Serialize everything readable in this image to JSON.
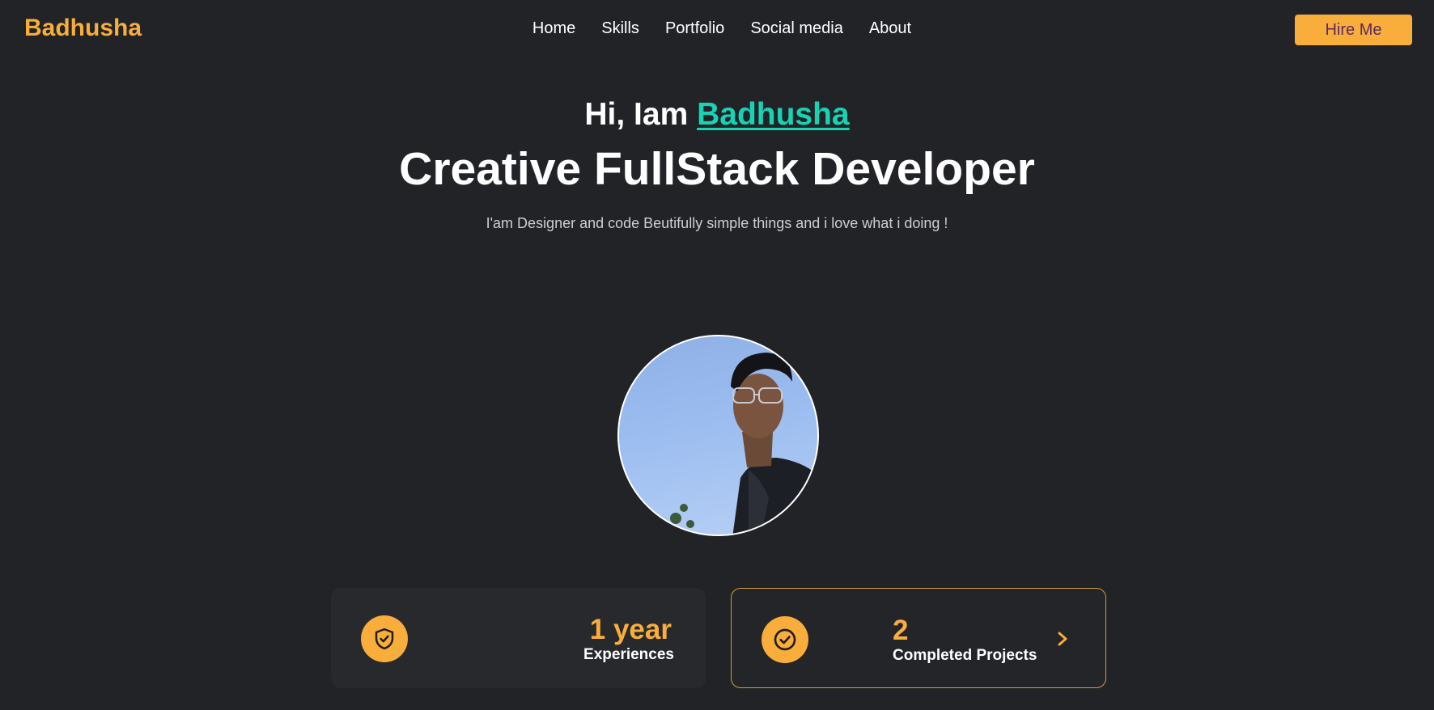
{
  "header": {
    "brand": "Badhusha",
    "nav": [
      "Home",
      "Skills",
      "Portfolio",
      "Social media",
      "About"
    ],
    "cta_label": "Hire Me"
  },
  "hero": {
    "greeting_prefix": "Hi, Iam",
    "name": "Badhusha",
    "headline": "Creative FullStack Developer",
    "tagline": "I'am Designer and code Beutifully simple things and i love what i doing !"
  },
  "stats": {
    "experience": {
      "value": "1 year",
      "label": "Experiences",
      "icon": "shield-check-icon"
    },
    "projects": {
      "value": "2",
      "label": "Completed Projects",
      "icon": "check-circle-icon",
      "action_icon": "chevron-right-icon"
    }
  },
  "colors": {
    "background": "#212327",
    "accent": "#f9ad3a",
    "name_highlight": "#18d2b4",
    "text": "#ffffff"
  }
}
